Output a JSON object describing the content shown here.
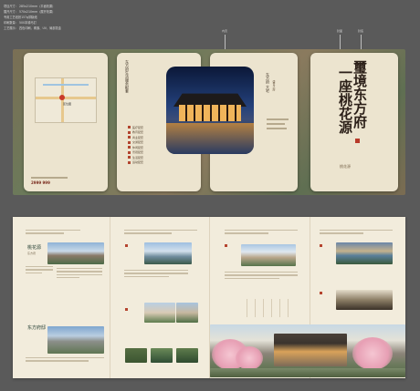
{
  "spec": {
    "lines": [
      "项目尺寸： 285x210mm（平面效果）",
      "展开尺寸： 570x210mm（展开效果）",
      "专用工艺纸张157g铜版纸",
      "印刷数量： 500本骑马钉",
      "工艺展示： 四色印刷、覆膜、UV、局部烫金"
    ]
  },
  "callouts": [
    "封面",
    "封底",
    "内页"
  ],
  "map": {
    "label": "区位图"
  },
  "panel2": {
    "heading": "东方府生活服务配套",
    "list": [
      "医疗配套",
      "教育配套",
      "商业配套",
      "交通配套",
      "休闲配套",
      "景观配套",
      "生活配套",
      "运动配套"
    ]
  },
  "panel3": {
    "caption": "东方府 大宅",
    "subcaption": "盛世之府"
  },
  "cover": {
    "title_lines": [
      "璽境东方府",
      "一座桃花源"
    ],
    "brand": "桃花源"
  },
  "hotline": "2999 999",
  "spread": {
    "p1_title": "桃花源",
    "p1_sub": "东方府",
    "p1_title2": "东方府邸"
  }
}
